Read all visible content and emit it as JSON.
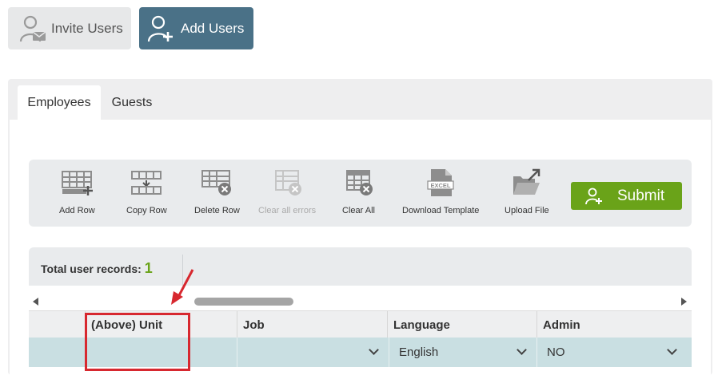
{
  "header_buttons": {
    "invite_label": "Invite Users",
    "add_label": "Add Users"
  },
  "tabs": [
    {
      "label": "Employees",
      "active": true
    },
    {
      "label": "Guests",
      "active": false
    }
  ],
  "toolbar": {
    "items": [
      {
        "label": "Add Row",
        "icon": "add-row-icon",
        "enabled": true
      },
      {
        "label": "Copy Row",
        "icon": "copy-row-icon",
        "enabled": true
      },
      {
        "label": "Delete Row",
        "icon": "delete-row-icon",
        "enabled": true
      },
      {
        "label": "Clear all errors",
        "icon": "clear-errors-icon",
        "enabled": false
      },
      {
        "label": "Clear All",
        "icon": "clear-all-icon",
        "enabled": true
      },
      {
        "label": "Download Template",
        "icon": "excel-file-icon",
        "enabled": true
      },
      {
        "label": "Upload File",
        "icon": "upload-folder-icon",
        "enabled": true
      }
    ],
    "submit_label": "Submit"
  },
  "records": {
    "label": "Total user records:",
    "count": "1"
  },
  "table": {
    "columns": [
      "(Above) Unit",
      "Job",
      "Language",
      "Admin"
    ],
    "row": {
      "unit": "",
      "job": "",
      "language": "English",
      "admin": "NO"
    }
  },
  "colors": {
    "accent_blue": "#4a7187",
    "submit_green": "#6aa319",
    "row_highlight": "#c9dfe2",
    "callout_red": "#d7282f"
  }
}
